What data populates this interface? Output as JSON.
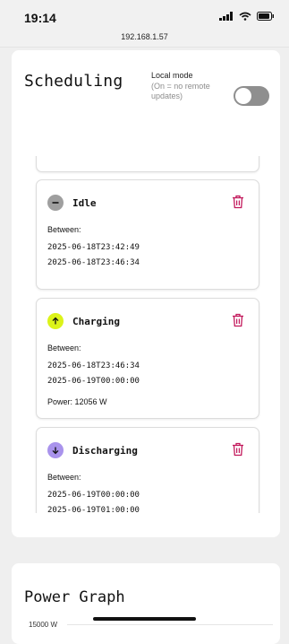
{
  "status": {
    "time": "19:14"
  },
  "browser": {
    "url": "192.168.1.57"
  },
  "scheduling": {
    "title": "Scheduling",
    "local_mode": {
      "label": "Local mode",
      "hint": "(On = no remote updates)",
      "enabled": false
    }
  },
  "events": [
    {
      "type": "Idle",
      "between_label": "Between:",
      "start": "2025-06-18T23:42:49",
      "end": "2025-06-18T23:46:34"
    },
    {
      "type": "Charging",
      "between_label": "Between:",
      "start": "2025-06-18T23:46:34",
      "end": "2025-06-19T00:00:00",
      "power": "Power: 12056 W"
    },
    {
      "type": "Discharging",
      "between_label": "Between:",
      "start": "2025-06-19T00:00:00",
      "end": "2025-06-19T01:00:00"
    }
  ],
  "power_graph": {
    "title": "Power Graph",
    "top_tick": "15000 W"
  },
  "colors": {
    "idle": "#9f9f9f",
    "charging": "#dcf31a",
    "discharging": "#a993ec",
    "trash": "#c2185b"
  },
  "icons": {
    "idle": "minus-icon",
    "charging": "arrow-up-icon",
    "discharging": "arrow-down-icon",
    "delete": "trash-icon"
  }
}
